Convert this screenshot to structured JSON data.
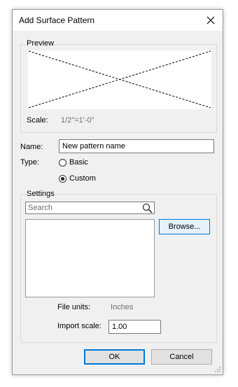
{
  "window": {
    "title": "Add Surface Pattern"
  },
  "preview": {
    "group_label": "Preview",
    "scale_label": "Scale:",
    "scale_value": "1/2\"=1'-0\""
  },
  "name": {
    "label": "Name:",
    "value": "New pattern name"
  },
  "type": {
    "label": "Type:",
    "options": [
      {
        "label": "Basic",
        "selected": false
      },
      {
        "label": "Custom",
        "selected": true
      }
    ]
  },
  "settings": {
    "group_label": "Settings",
    "search_placeholder": "Search",
    "browse_label": "Browse...",
    "file_units_label": "File units:",
    "file_units_value": "Inches",
    "import_scale_label": "Import scale:",
    "import_scale_value": "1.00"
  },
  "footer": {
    "ok_label": "OK",
    "cancel_label": "Cancel"
  }
}
